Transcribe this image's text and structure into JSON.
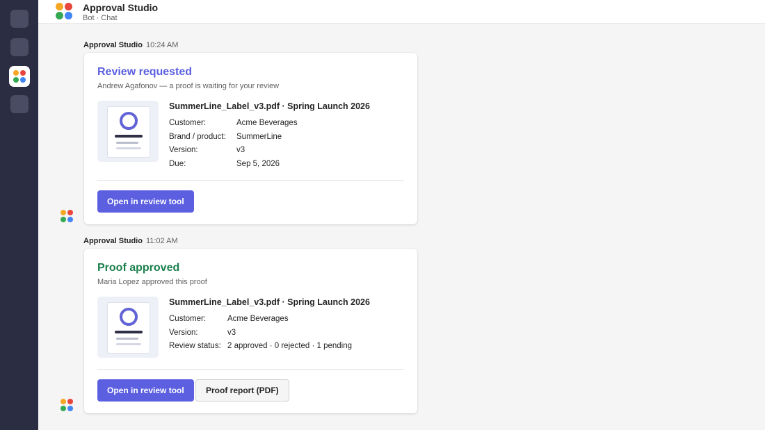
{
  "app": {
    "title": "Approval Studio",
    "subtitle": "Bot · Chat"
  },
  "rail": {
    "icons": [
      "rail-app-1",
      "rail-app-2",
      "approval-studio-logo-icon",
      "rail-app-4"
    ]
  },
  "colors": {
    "accent": "#5b5fe0",
    "review_title": "#5b5fe0",
    "approved_title": "#1a7f4b",
    "rail_bg": "#2b2d42"
  },
  "messages": [
    {
      "sender": "Approval Studio",
      "time": "10:24 AM",
      "card": {
        "title": "Review requested",
        "subtitle": "Andrew Agafonov — a proof is waiting for your review",
        "file_title": "SummerLine_Label_v3.pdf · Spring Launch 2026",
        "facts": [
          {
            "label": "Customer:",
            "value": "Acme Beverages"
          },
          {
            "label": "Brand / product:",
            "value": "SummerLine"
          },
          {
            "label": "Version:",
            "value": "v3"
          },
          {
            "label": "Due:",
            "value": "Sep 5, 2026"
          }
        ],
        "actions": [
          "Open in review tool"
        ]
      }
    },
    {
      "sender": "Approval Studio",
      "time": "11:02 AM",
      "card": {
        "title": "Proof approved",
        "subtitle": "Maria Lopez approved this proof",
        "file_title": "SummerLine_Label_v3.pdf · Spring Launch 2026",
        "facts": [
          {
            "label": "Customer:",
            "value": "Acme Beverages"
          },
          {
            "label": "Version:",
            "value": "v3"
          },
          {
            "label": "Review status:",
            "value": "2 approved · 0 rejected · 1 pending"
          }
        ],
        "actions": [
          "Open in review tool",
          "Proof report (PDF)"
        ]
      }
    }
  ]
}
